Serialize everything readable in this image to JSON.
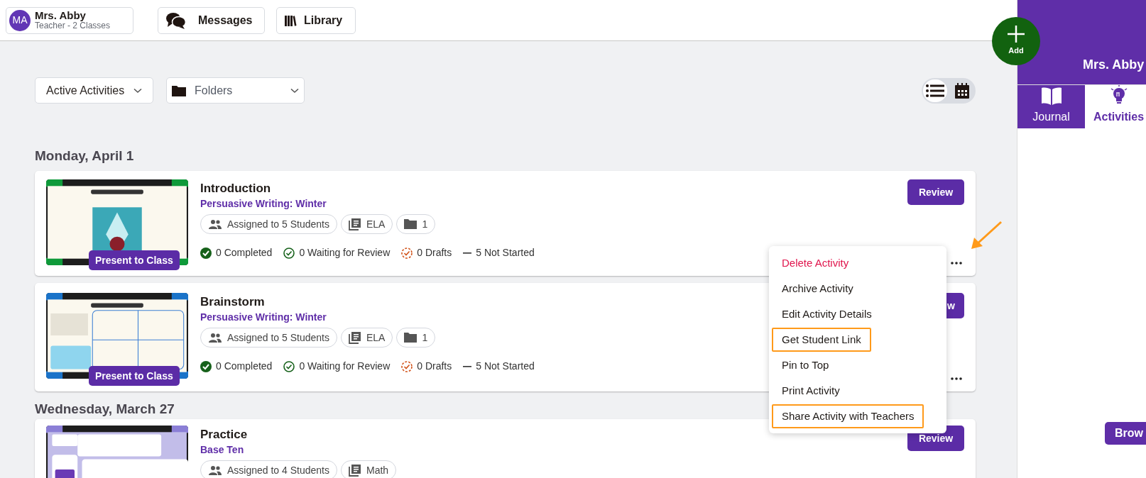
{
  "header": {
    "user": {
      "initials": "MA",
      "name": "Mrs. Abby",
      "role": "Teacher - 2 Classes"
    },
    "buttons": [
      {
        "label": "Messages"
      },
      {
        "label": "Library"
      }
    ]
  },
  "add_button": {
    "label": "Add"
  },
  "filters": {
    "status": "Active Activities",
    "folder": "Folders"
  },
  "view_toggle": [
    {
      "kind": "list",
      "selected": true
    },
    {
      "kind": "calendar",
      "selected": false
    }
  ],
  "groups": [
    {
      "date": "Monday, April 1",
      "activities": [
        {
          "title": "Introduction",
          "unit": "Persuasive Writing: Winter",
          "assigned": "Assigned to 5 Students",
          "subject": "ELA",
          "folders": "1",
          "present": "Present to Class",
          "review": "Review",
          "menu_dots": true,
          "statuses": [
            {
              "kind": "completed",
              "text": "0 Completed"
            },
            {
              "kind": "waiting",
              "text": "0 Waiting for Review"
            },
            {
              "kind": "drafts",
              "text": "0 Drafts"
            },
            {
              "kind": "not_started",
              "text": "5 Not Started"
            }
          ]
        },
        {
          "title": "Brainstorm",
          "unit": "Persuasive Writing: Winter",
          "assigned": "Assigned to 5 Students",
          "subject": "ELA",
          "folders": "1",
          "present": "Present to Class",
          "review": "w",
          "menu_dots": true,
          "statuses": [
            {
              "kind": "completed",
              "text": "0 Completed"
            },
            {
              "kind": "waiting",
              "text": "0 Waiting for Review"
            },
            {
              "kind": "drafts",
              "text": "0 Drafts"
            },
            {
              "kind": "not_started",
              "text": "5 Not Started"
            }
          ]
        }
      ]
    },
    {
      "date": "Wednesday, March 27",
      "activities": [
        {
          "title": "Practice",
          "unit": "Base Ten",
          "assigned": "Assigned to 4 Students",
          "subject": "Math",
          "review": "Review"
        }
      ]
    }
  ],
  "context_menu": {
    "items": [
      {
        "label": "Delete Activity",
        "kind": "danger",
        "highlighted": false
      },
      {
        "label": "Archive Activity",
        "kind": "normal",
        "highlighted": false
      },
      {
        "label": "Edit Activity Details",
        "kind": "normal",
        "highlighted": false
      },
      {
        "label": "Get Student Link",
        "kind": "normal",
        "highlighted": true
      },
      {
        "label": "Pin to Top",
        "kind": "normal",
        "highlighted": false
      },
      {
        "label": "Print Activity",
        "kind": "normal",
        "highlighted": false
      },
      {
        "label": "Share Activity with Teachers",
        "kind": "normal",
        "highlighted": true
      }
    ]
  },
  "side_panel": {
    "name": "Mrs. Abby",
    "tabs": [
      {
        "label": "Journal",
        "selected": false
      },
      {
        "label": "Activities",
        "selected": true
      }
    ],
    "button": "Brow"
  }
}
